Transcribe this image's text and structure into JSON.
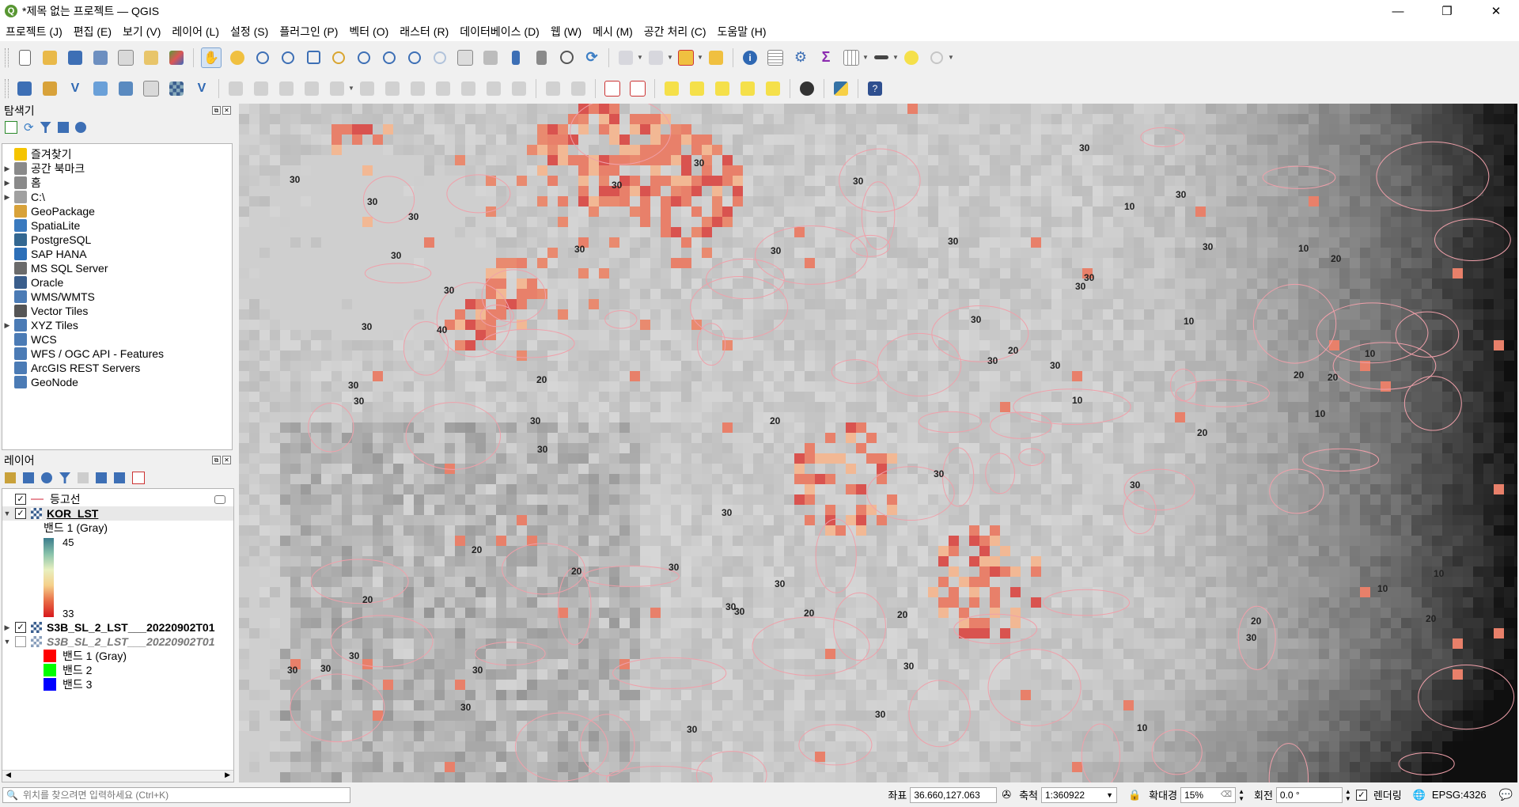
{
  "window": {
    "title": "*제목 없는 프로젝트 — QGIS",
    "app_icon": "Q",
    "minimize": "—",
    "restore": "❐",
    "close": "✕"
  },
  "menu": [
    "프로젝트 (J)",
    "편집 (E)",
    "보기 (V)",
    "레이어 (L)",
    "설정 (S)",
    "플러그인 (P)",
    "벡터 (O)",
    "래스터 (R)",
    "데이터베이스 (D)",
    "웹 (W)",
    "메시 (M)",
    "공간 처리 (C)",
    "도움말 (H)"
  ],
  "browser_panel": {
    "title": "탐색기",
    "items": [
      {
        "label": "즐겨찾기",
        "icon": "star-icon",
        "color": "#f5c400",
        "expand": ""
      },
      {
        "label": "공간 북마크",
        "icon": "bookmark-icon",
        "color": "#8a8a8a",
        "expand": "▶"
      },
      {
        "label": "홈",
        "icon": "home-icon",
        "color": "#8a8a8a",
        "expand": "▶"
      },
      {
        "label": "C:\\",
        "icon": "drive-icon",
        "color": "#a0a0a0",
        "expand": "▶"
      },
      {
        "label": "GeoPackage",
        "icon": "geopackage-icon",
        "color": "#d8a23a",
        "expand": ""
      },
      {
        "label": "SpatiaLite",
        "icon": "spatialite-icon",
        "color": "#3a7abf",
        "expand": ""
      },
      {
        "label": "PostgreSQL",
        "icon": "postgresql-icon",
        "color": "#336791",
        "expand": ""
      },
      {
        "label": "SAP HANA",
        "icon": "sap-hana-icon",
        "color": "#2d6fb8",
        "expand": ""
      },
      {
        "label": "MS SQL Server",
        "icon": "mssql-icon",
        "color": "#6b6b6b",
        "expand": ""
      },
      {
        "label": "Oracle",
        "icon": "oracle-icon",
        "color": "#3a5e8c",
        "expand": ""
      },
      {
        "label": "WMS/WMTS",
        "icon": "wms-icon",
        "color": "#4b7bb5",
        "expand": ""
      },
      {
        "label": "Vector Tiles",
        "icon": "vector-tiles-icon",
        "color": "#555555",
        "expand": ""
      },
      {
        "label": "XYZ Tiles",
        "icon": "xyz-tiles-icon",
        "color": "#4b7bb5",
        "expand": "▶"
      },
      {
        "label": "WCS",
        "icon": "wcs-icon",
        "color": "#4b7bb5",
        "expand": ""
      },
      {
        "label": "WFS / OGC API - Features",
        "icon": "wfs-icon",
        "color": "#4b7bb5",
        "expand": ""
      },
      {
        "label": "ArcGIS REST Servers",
        "icon": "arcgis-icon",
        "color": "#4b7bb5",
        "expand": ""
      },
      {
        "label": "GeoNode",
        "icon": "geonode-icon",
        "color": "#4b7bb5",
        "expand": ""
      }
    ]
  },
  "layers_panel": {
    "title": "레이어",
    "layers": {
      "contour": {
        "name": "등고선",
        "checked": true,
        "color": "#e8909a"
      },
      "kor_lst": {
        "name": "KOR_LST",
        "checked": true,
        "band": "밴드 1 (Gray)",
        "max": "45",
        "min": "33"
      },
      "s3b_1": {
        "name": "S3B_SL_2_LST___20220902T01",
        "checked": true
      },
      "s3b_2": {
        "name": "S3B_SL_2_LST___20220902T01",
        "checked": false,
        "bands": [
          {
            "label": "밴드 1 (Gray)",
            "color": "#ff0000"
          },
          {
            "label": "밴드 2",
            "color": "#00ff00"
          },
          {
            "label": "밴드 3",
            "color": "#0000ff"
          }
        ]
      }
    }
  },
  "map": {
    "labels_cool": [
      "30",
      "30",
      "30",
      "30",
      "30",
      "30",
      "30",
      "30",
      "30",
      "30",
      "30",
      "30",
      "30",
      "30",
      "30",
      "30",
      "30",
      "30",
      "30",
      "30",
      "30",
      "30",
      "30",
      "30",
      "30",
      "30",
      "30",
      "30",
      "30",
      "30",
      "30",
      "30",
      "30",
      "30",
      "30",
      "30",
      "30",
      "30",
      "30",
      "30",
      "20",
      "20",
      "20",
      "20",
      "20",
      "20",
      "20",
      "20",
      "20",
      "20",
      "20",
      "20",
      "20",
      "20",
      "10",
      "10",
      "10",
      "10",
      "10",
      "10",
      "10",
      "10",
      "10",
      "40"
    ]
  },
  "statusbar": {
    "search_placeholder": "위치를 찾으려면 입력하세요 (Ctrl+K)",
    "coord_label": "좌표",
    "coord_value": "36.660,127.063",
    "scale_label": "축척",
    "scale_value": "1:360922",
    "magnifier_label": "확대경",
    "magnifier_value": "15%",
    "rotation_label": "회전",
    "rotation_value": "0.0 °",
    "render_label": "렌더링",
    "crs": "EPSG:4326"
  }
}
